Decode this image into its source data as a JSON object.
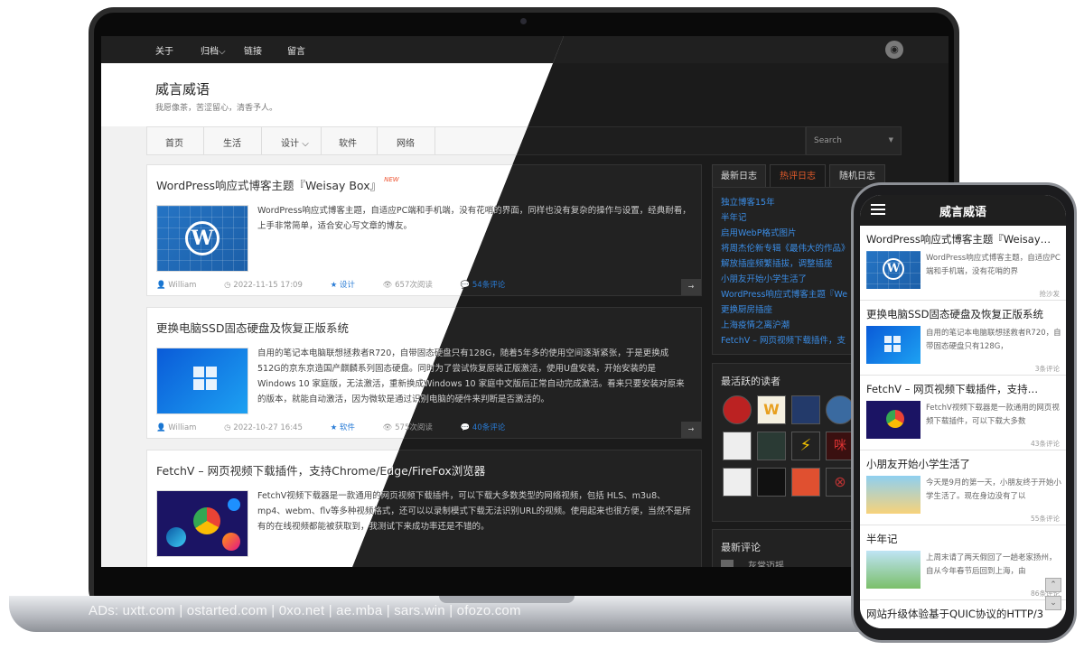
{
  "ads_text": "ADs: uxtt.com | ostarted.com | 0xo.net | ae.mba | sars.win | ofozo.com",
  "topbar": {
    "items": [
      "关于",
      "归档",
      "链接",
      "留言"
    ],
    "archive_chevron": "⌵"
  },
  "site": {
    "title": "威言威语",
    "subtitle": "我愿像茶，苦涩留心，清香予人。"
  },
  "nav": {
    "items": [
      "首页",
      "生活",
      "设计",
      "软件",
      "网络"
    ],
    "chevron": "⌵"
  },
  "search": {
    "placeholder": "Search",
    "arrow": "▼"
  },
  "posts": [
    {
      "title": "WordPress响应式博客主题『Weisay Box』",
      "badge": "NEW",
      "excerpt": "WordPress响应式博客主题，自适应PC端和手机端，没有花哨的界面，同样也没有复杂的操作与设置，经典耐看，上手非常简单，适合安心写文章的博友。",
      "author": "William",
      "date": "2022-11-15 17:09",
      "category": "设计",
      "views": "657次阅读",
      "comments": "54条评论",
      "more": "→"
    },
    {
      "title": "更换电脑SSD固态硬盘及恢复正版系统",
      "excerpt": "自用的笔记本电脑联想拯救者R720，自带固态硬盘只有128G，随着5年多的使用空间逐渐紧张，于是更换成512G的京东京造国产麒麟系列固态硬盘。同时为了尝试恢复原装正版激活，使用U盘安装，开始安装的是Windows 10 家庭版，无法激活，重新换成Windows 10 家庭中文版后正常自动完成激活。看来只要安装对原来的版本，就能自动激活，因为微软是通过识别电脑的硬件来判断是否激活的。",
      "author": "William",
      "date": "2022-10-27 16:45",
      "category": "软件",
      "views": "575次阅读",
      "comments": "40条评论",
      "more": "→"
    },
    {
      "title": "FetchV – 网页视频下载插件，支持Chrome/Edge/FireFox浏览器",
      "excerpt": "FetchV视频下载器是一款通用的网页视频下载插件，可以下载大多数类型的网络视频，包括 HLS、m3u8、mp4、webm、flv等多种视频格式，还可以以录制模式下载无法识别URL的视频。使用起来也很方便，当然不是所有的在线视频都能被获取到，我测试下来成功率还是不错的。"
    }
  ],
  "sidebar": {
    "tabs": [
      "最新日志",
      "热评日志",
      "随机日志"
    ],
    "hot_posts": [
      "独立博客15年",
      "半年记",
      "启用WebP格式图片",
      "将周杰伦新专辑《最伟大的作品》",
      "解放插座频繁插拔，调整插座",
      "小朋友开始小学生活了",
      "WordPress响应式博客主题『We",
      "更换厨房插座",
      "上海疫情之离沪潮",
      "FetchV – 网页视频下载插件，支"
    ],
    "readers_title": "最活跃的读者",
    "reader_glyphs": [
      "",
      "W",
      "",
      "",
      "",
      "",
      "⚡",
      "咪",
      "",
      "",
      "",
      "⊗"
    ],
    "comments_title": "最新评论",
    "comment_preview": "灰常迈摇"
  },
  "phone": {
    "title": "威言威语",
    "posts": [
      {
        "title": "WordPress响应式博客主题『Weisay…",
        "excerpt": "WordPress响应式博客主题，自适应PC端和手机端，没有花哨的界",
        "meta": "抢沙发"
      },
      {
        "title": "更换电脑SSD固态硬盘及恢复正版系统",
        "excerpt": "自用的笔记本电脑联想拯救者R720，自带固态硬盘只有128G，",
        "meta": "3条评论"
      },
      {
        "title": "FetchV – 网页视频下载插件，支持…",
        "excerpt": "FetchV视频下载器是一款通用的网页视频下载插件，可以下载大多数",
        "meta": "43条评论"
      },
      {
        "title": "小朋友开始小学生活了",
        "excerpt": "今天是9月的第一天，小朋友终于开始小学生活了。现在身边没有了以",
        "meta": "55条评论"
      },
      {
        "title": "半年记",
        "excerpt": "上周末请了两天假回了一趟老家扬州，自从今年春节后回到上海，由",
        "meta": "86条评论"
      },
      {
        "title": "网站升级体验基于QUIC协议的HTTP/3"
      }
    ],
    "scroll_up": "⌃",
    "scroll_down": "⌄"
  },
  "colors": {
    "accent_orange": "#e05a2a",
    "link_blue": "#3b8de6",
    "dark_bg": "#1b1b1b"
  }
}
